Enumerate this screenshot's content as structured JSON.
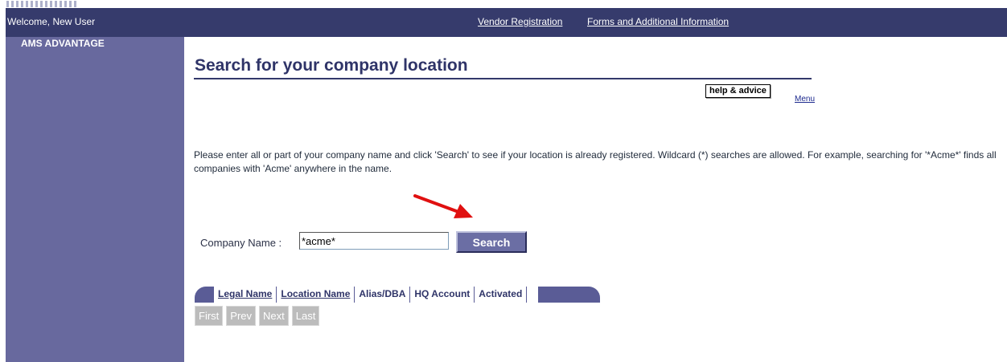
{
  "header": {
    "welcome": "Welcome, New User",
    "links": [
      "Vendor Registration",
      "Forms and Additional Information"
    ],
    "background": "#363b6c"
  },
  "sidebar": {
    "title": "AMS ADVANTAGE",
    "background": "#68699e"
  },
  "page": {
    "title": "Search for your company location",
    "help_label": "help & advice",
    "menu_label": "Menu",
    "instructions": "Please enter all or part of your company name and click 'Search' to see if your location is already registered. Wildcard (*) searches are allowed. For example, searching for '*Acme*' finds all companies with 'Acme' anywhere in the name."
  },
  "search": {
    "label": "Company Name :",
    "value": "*acme*",
    "button_label": "Search"
  },
  "results_table": {
    "columns": [
      {
        "label": "Legal Name",
        "link": true
      },
      {
        "label": "Location Name",
        "link": true
      },
      {
        "label": "Alias/DBA",
        "link": false
      },
      {
        "label": "HQ Account",
        "link": false
      },
      {
        "label": "Activated",
        "link": false
      }
    ]
  },
  "pager": {
    "buttons": [
      "First",
      "Prev",
      "Next",
      "Last"
    ]
  },
  "annotation": {
    "arrow_color": "#e01010",
    "arrow_icon": "red-arrow-icon"
  }
}
